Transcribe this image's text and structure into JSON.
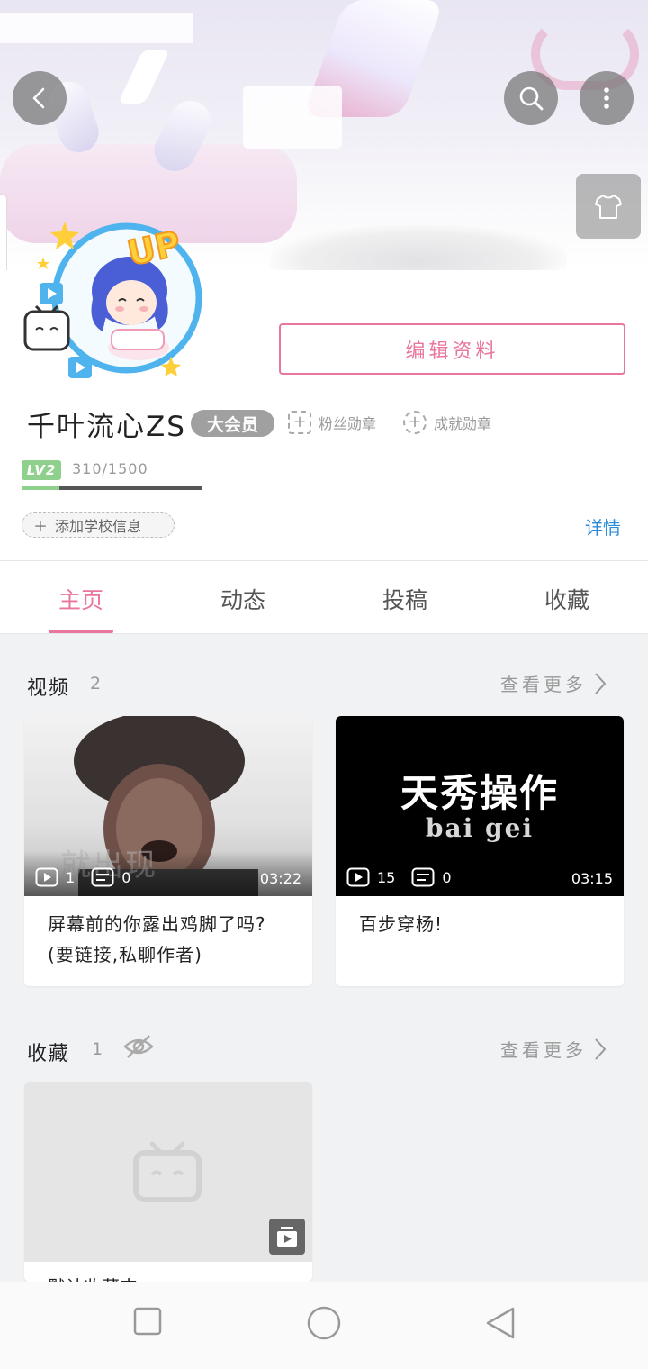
{
  "profile": {
    "username": "千叶流心ZS",
    "vip_label": "大会员",
    "fan_medal_label": "粉丝勋章",
    "achievement_medal_label": "成就勋章",
    "edit_button_label": "编辑资料",
    "level_label": "LV2",
    "exp_text": "310/1500",
    "exp_progress": 0.21,
    "add_school_label": "添加学校信息",
    "detail_link": "详情",
    "avatar_badge_text": "UP"
  },
  "tabs": [
    {
      "label": "主页",
      "active": true
    },
    {
      "label": "动态",
      "active": false
    },
    {
      "label": "投稿",
      "active": false
    },
    {
      "label": "收藏",
      "active": false
    }
  ],
  "videos_section": {
    "title": "视频",
    "count": "2",
    "see_more": "查看更多",
    "videos": [
      {
        "title": "屏幕前的你露出鸡脚了吗?(要链接,私聊作者)",
        "plays": "1",
        "danmaku": "0",
        "duration": "03:22",
        "caption": "就出现"
      },
      {
        "title": "百步穿杨!",
        "plays": "15",
        "danmaku": "0",
        "duration": "03:15",
        "caption_cn": "天秀操作",
        "caption_en": "bai gei"
      }
    ]
  },
  "favorites_section": {
    "title": "收藏",
    "count": "1",
    "see_more": "查看更多",
    "folder_title": "默认收藏夹"
  },
  "colors": {
    "accent_pink": "#e9769c",
    "link_blue": "#2b8bd9",
    "level_green": "#8fd18c"
  },
  "icons": {
    "back": "back-arrow-icon",
    "search": "search-icon",
    "more": "more-vertical-icon",
    "dress": "t-shirt-icon",
    "see_more": "chevron-right-icon",
    "hidden": "eye-off-icon"
  }
}
